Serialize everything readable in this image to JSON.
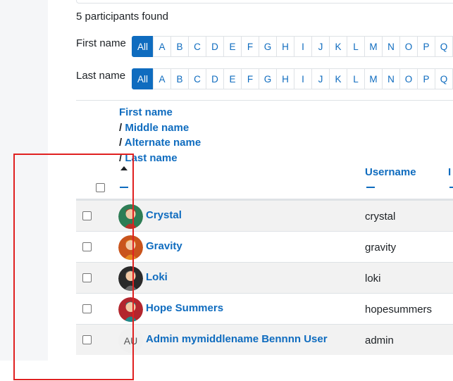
{
  "participants_found": "5 participants found",
  "first_name_filter": {
    "label": "First name",
    "letters": [
      "All",
      "A",
      "B",
      "C",
      "D",
      "E",
      "F",
      "G",
      "H",
      "I",
      "J",
      "K",
      "L",
      "M",
      "N",
      "O",
      "P",
      "Q"
    ]
  },
  "last_name_filter": {
    "label": "Last name",
    "letters": [
      "All",
      "A",
      "B",
      "C",
      "D",
      "E",
      "F",
      "G",
      "H",
      "I",
      "J",
      "K",
      "L",
      "M",
      "N",
      "O",
      "P",
      "Q"
    ]
  },
  "table_header": {
    "first_name": "First name",
    "middle_name": "Middle name",
    "alternate_name": "Alternate name",
    "last_name": "Last name",
    "separator": "/",
    "username": "Username",
    "next_col": "I"
  },
  "rows": [
    {
      "name": "Crystal",
      "username": "crystal",
      "avatar_color": "#b8342a",
      "avatar_bg": "#2e7d55"
    },
    {
      "name": "Gravity",
      "username": "gravity",
      "avatar_color": "#e58a1f",
      "avatar_bg": "#c9541c"
    },
    {
      "name": "Loki",
      "username": "loki",
      "avatar_color": "#6a6a6a",
      "avatar_bg": "#2a2a2a"
    },
    {
      "name": "Hope Summers",
      "username": "hopesummers",
      "avatar_color": "#1d8a8a",
      "avatar_bg": "#b3262e"
    },
    {
      "name": "Admin mymiddlename Bennnn User",
      "username": "admin",
      "initials": "AU"
    }
  ],
  "colors": {
    "accent": "#0f6cbf",
    "highlight_box": "#e02020"
  }
}
